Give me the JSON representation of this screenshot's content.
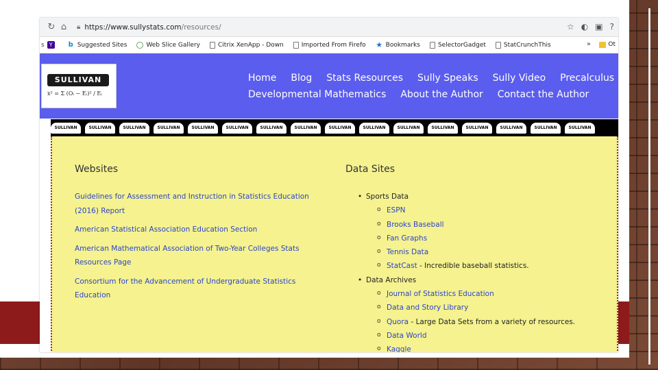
{
  "browser": {
    "url_domain": "https://www.sullystats.com",
    "url_path": "/resources/",
    "bookmarks": [
      {
        "label": "Suggested Sites",
        "icon": "bing-icon"
      },
      {
        "label": "Web Slice Gallery",
        "icon": "globe-icon"
      },
      {
        "label": "Citrix XenApp - Down",
        "icon": "page-icon"
      },
      {
        "label": "Imported From Firefo",
        "icon": "page-icon"
      },
      {
        "label": "Bookmarks",
        "icon": "star-icon"
      },
      {
        "label": "SelectorGadget",
        "icon": "page-icon"
      },
      {
        "label": "StatCrunchThis",
        "icon": "page-icon"
      }
    ],
    "bookmarks_more": "»",
    "bookmarks_folder": "Ot"
  },
  "site": {
    "logo_text": "SULLIVAN",
    "logo_formula": "x² = Σ (Oᵢ − Eᵢ)² / Eᵢ",
    "nav_row1": [
      "Home",
      "Blog",
      "Stats Resources",
      "Sully Speaks",
      "Sully Video",
      "Precalculus"
    ],
    "nav_row2": [
      "Developmental Mathematics",
      "About the Author",
      "Contact the Author"
    ],
    "pattern_label": "SULLIVAN"
  },
  "websites": {
    "title": "Websites",
    "links": [
      "Guidelines for Assessment and Instruction in Statistics Education (2016) Report",
      "American Statistical Association Education Section",
      "American Mathematical Association of Two-Year Colleges Stats Resources Page",
      "Consortium for the Advancement of Undergraduate Statistics Education"
    ]
  },
  "data_sites": {
    "title": "Data Sites",
    "sports_label": "Sports Data",
    "sports": [
      {
        "link": "ESPN",
        "desc": ""
      },
      {
        "link": "Brooks Baseball",
        "desc": ""
      },
      {
        "link": "Fan Graphs",
        "desc": ""
      },
      {
        "link": "Tennis Data",
        "desc": ""
      },
      {
        "link": "StatCast",
        "desc": " - Incredible baseball statistics."
      }
    ],
    "archives_label": "Data Archives",
    "archives": [
      {
        "link": "Journal of Statistics Education",
        "desc": ""
      },
      {
        "link": "Data and Story Library",
        "desc": ""
      },
      {
        "link": "Quora",
        "desc": " - Large Data Sets from a variety of resources."
      },
      {
        "link": "Data World",
        "desc": ""
      },
      {
        "link": "Kaggle",
        "desc": ""
      }
    ]
  }
}
